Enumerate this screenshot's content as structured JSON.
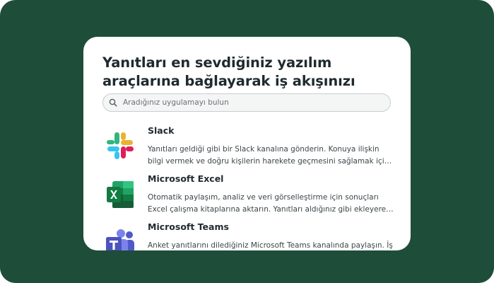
{
  "colors": {
    "background": "#1e4d3a",
    "card": "#ffffff",
    "text_primary": "#1f2a30",
    "text_secondary": "#3d4549",
    "excel_green": "#1d6f42",
    "teams_purple": "#5b5fc7"
  },
  "card": {
    "title": "Yanıtları en sevdiğiniz yazılım araçlarına bağlayarak iş akışınızı otomatik hale getirin"
  },
  "search": {
    "icon": "search-icon",
    "placeholder": "Aradığınız uygulamayı bulun",
    "value": ""
  },
  "integrations": [
    {
      "icon": "slack-logo-icon",
      "name": "Slack",
      "description": "Yanıtları geldiği gibi bir Slack kanalına gönderin. Konuya ilişkin bilgi vermek ve doğru kişilerin harekete geçmesini sağlamak için isteğe bağlı bildirimler ayarlayın."
    },
    {
      "icon": "microsoft-excel-icon",
      "name": "Microsoft Excel",
      "description": "Otomatik paylaşım, analiz ve veri görselleştirme için sonuçları Excel çalışma kitaplarına aktarın. Yanıtları aldığınız gibi ekleyerek anlık doğruluk sağlayın."
    },
    {
      "icon": "microsoft-teams-icon",
      "name": "Microsoft Teams",
      "description": "Anket yanıtlarını dilediğiniz Microsoft Teams kanalında paylaşın. İş birliğini kolaylaştırın."
    }
  ]
}
